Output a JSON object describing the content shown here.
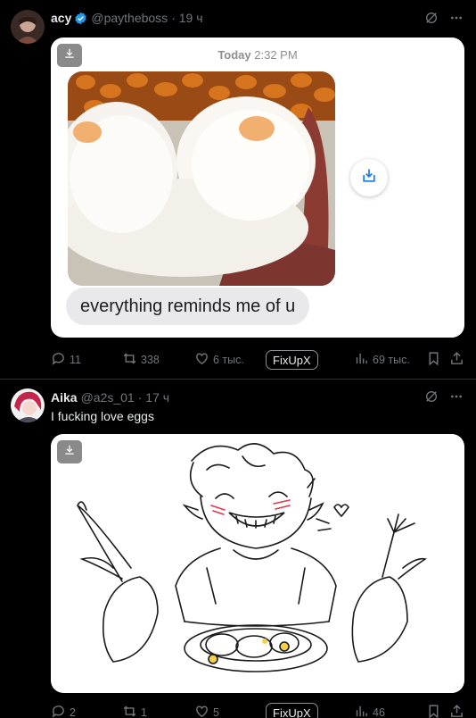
{
  "tweets": [
    {
      "name": "acy",
      "handle": "@paytheboss",
      "time": "· 19 ч",
      "verified": true,
      "media_timestamp_day": "Today",
      "media_timestamp_time": "2:32 PM",
      "media_bubble_text": "everything reminds me of u",
      "actions": {
        "replies": "11",
        "retweets": "338",
        "likes": "6 тыс.",
        "fixup": "FixUpX",
        "views": "69 тыс."
      }
    },
    {
      "name": "Aika",
      "handle": "@a2s_01",
      "time": "· 17 ч",
      "verified": false,
      "text": "I fucking love eggs",
      "actions": {
        "replies": "2",
        "retweets": "1",
        "likes": "5",
        "fixup": "FixUpX",
        "views": "46"
      }
    }
  ],
  "colors": {
    "background": "#000000",
    "text": "#e7e9ea",
    "muted": "#71767b",
    "verified": "#1d9bf0",
    "divider": "#2f3336"
  },
  "icons": [
    "more-icon",
    "grok-icon",
    "download-icon",
    "reply-icon",
    "retweet-icon",
    "like-icon",
    "views-icon",
    "bookmark-icon",
    "share-icon",
    "verified-badge-icon"
  ]
}
